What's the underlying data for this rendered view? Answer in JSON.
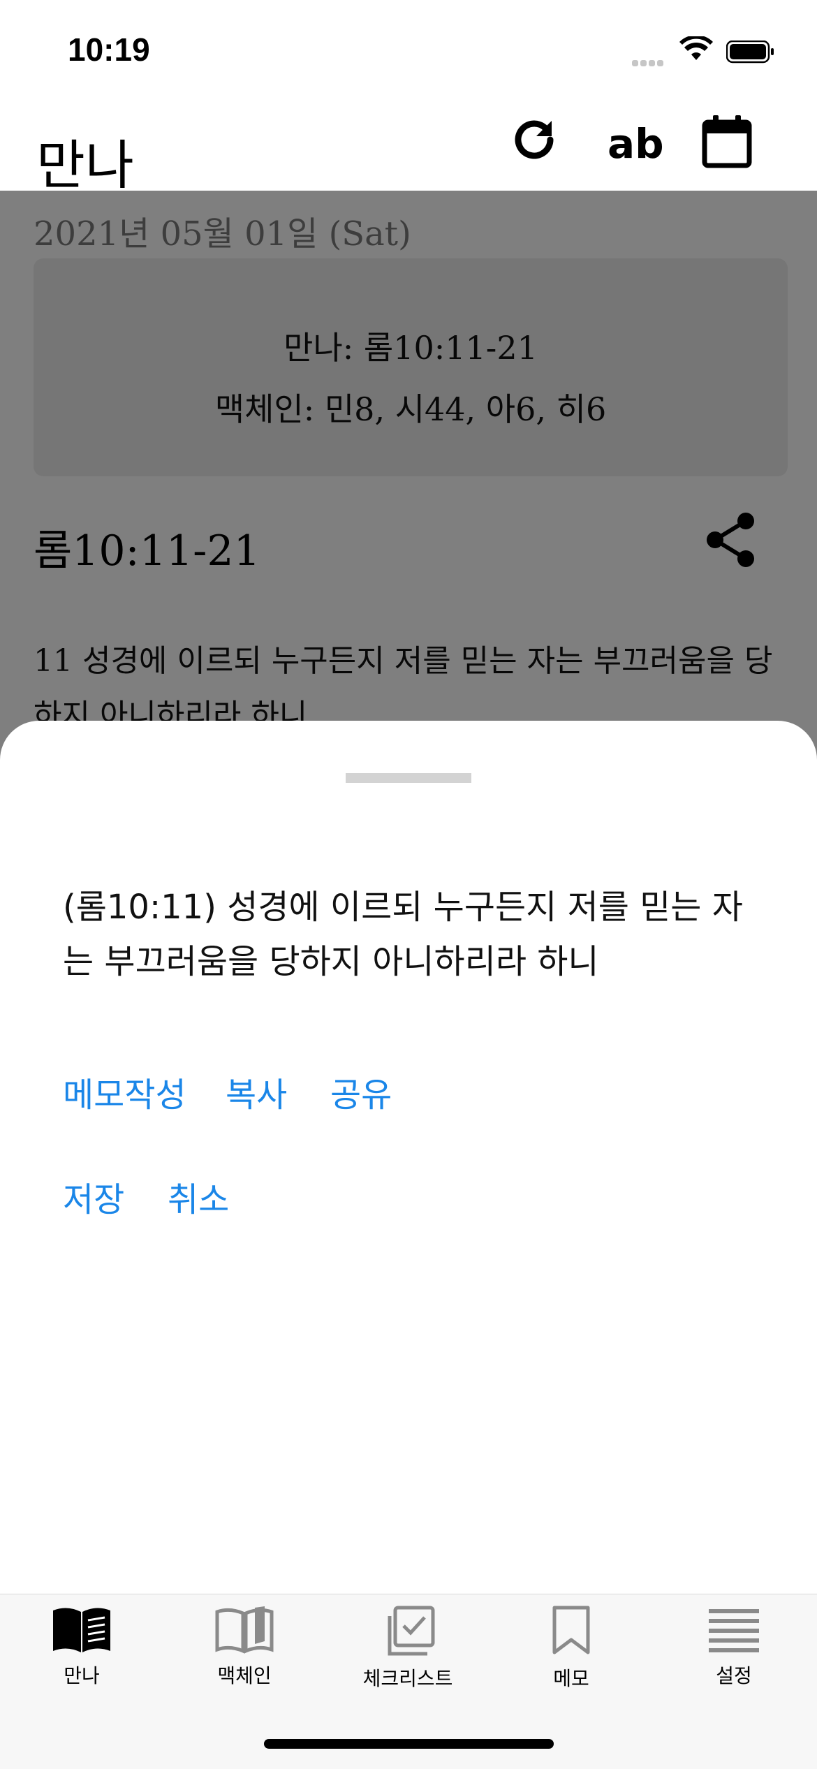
{
  "status": {
    "time": "10:19"
  },
  "nav": {
    "title": "만나",
    "refresh_icon": "refresh-icon",
    "font_label": "ab",
    "calendar_icon": "calendar-icon"
  },
  "content": {
    "date": "2021년 05월 01일 (Sat)",
    "reading": {
      "manna": "만나: 롬10:11-21",
      "maekchain": "맥체인: 민8, 시44, 아6, 히6"
    },
    "passage_title": "롬10:11-21",
    "verse_preview": "11 성경에 이르되 누구든지 저를 믿는 자는 부끄러움을 당하지 아니하리라 하니"
  },
  "sheet": {
    "verse": "(롬10:11) 성경에 이르되 누구든지 저를 믿는 자는 부끄러움을 당하지 아니하리라 하니",
    "actions": {
      "memo": "메모작성",
      "copy": "복사",
      "share": "공유",
      "save": "저장",
      "cancel": "취소"
    }
  },
  "tabs": [
    {
      "label": "만나",
      "icon": "open-book-icon",
      "active": true
    },
    {
      "label": "맥체인",
      "icon": "book-outline-icon",
      "active": false
    },
    {
      "label": "체크리스트",
      "icon": "checklist-icon",
      "active": false
    },
    {
      "label": "메모",
      "icon": "bookmark-icon",
      "active": false
    },
    {
      "label": "설정",
      "icon": "menu-lines-icon",
      "active": false
    }
  ],
  "colors": {
    "accent": "#1a86e8",
    "overlay": "rgba(0,0,0,0.5)"
  }
}
